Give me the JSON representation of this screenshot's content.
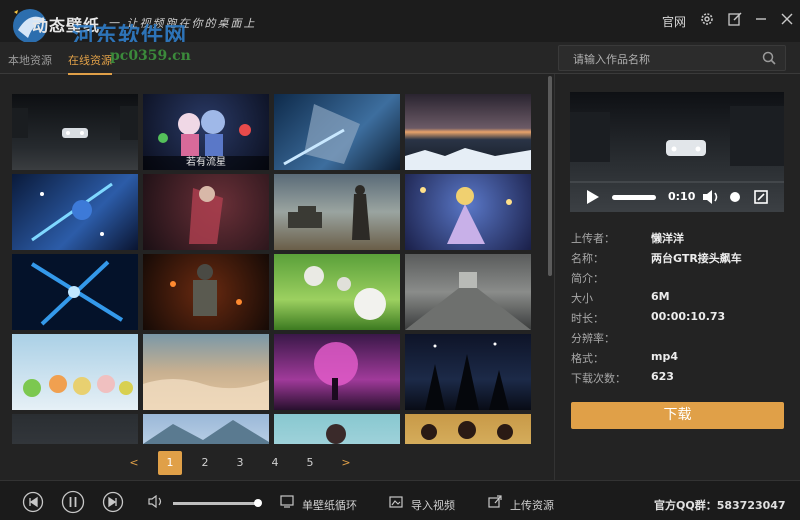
{
  "app": {
    "title": "动态壁纸",
    "slogan": "一 让视频跑在你的桌面上",
    "watermark": "河东软件网",
    "watermark_url": "pc0359.cn",
    "website_link": "官网"
  },
  "tabs": [
    {
      "label": "本地资源"
    },
    {
      "label": "在线资源"
    }
  ],
  "search": {
    "placeholder": "请输入作品名称"
  },
  "grid": {
    "tiles": [
      {
        "caption": ""
      },
      {
        "caption": "若有流星"
      }
    ]
  },
  "pagination": {
    "prev": "<",
    "pages": [
      "1",
      "2",
      "3",
      "4",
      "5"
    ],
    "current": "1",
    "next": ">"
  },
  "preview": {
    "time": "0:10"
  },
  "details": [
    {
      "label": "上传者：",
      "value": "懒洋洋"
    },
    {
      "label": "名称：",
      "value": "两台GTR接头飙车"
    },
    {
      "label": "简介：",
      "value": ""
    },
    {
      "label": "大小",
      "value": "6M"
    },
    {
      "label": "时长：",
      "value": "00:00:10.73"
    },
    {
      "label": "分辨率：",
      "value": ""
    },
    {
      "label": "格式：",
      "value": "mp4"
    },
    {
      "label": "下载次数：",
      "value": "623"
    }
  ],
  "download_label": "下载",
  "bottombar": {
    "loop_label": "单壁纸循环",
    "import_label": "导入视频",
    "upload_label": "上传资源",
    "qq_group": "官方QQ群：583723047",
    "volume_level": 0.98
  },
  "colors": {
    "accent": "#e0a048",
    "background": "#232323"
  }
}
